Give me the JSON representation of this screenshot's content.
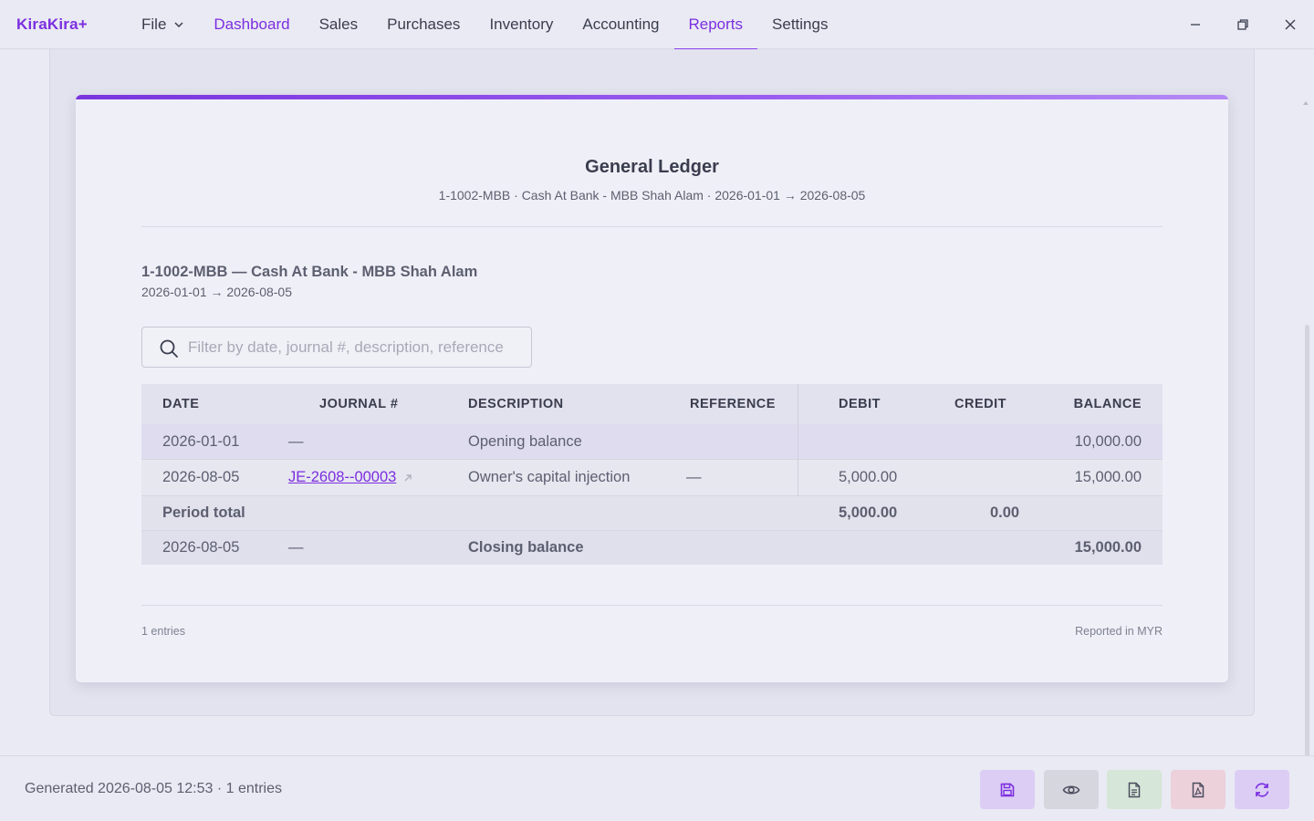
{
  "app": {
    "logo": "KiraKira+"
  },
  "menu": {
    "file": "File",
    "items": [
      "Dashboard",
      "Sales",
      "Purchases",
      "Inventory",
      "Accounting",
      "Reports",
      "Settings"
    ],
    "active": "Reports"
  },
  "report": {
    "title": "General Ledger",
    "subtitle": "1-1002-MBB · Cash At Bank - MBB Shah Alam · 2026-01-01 → 2026-08-05",
    "account_title": "1-1002-MBB — Cash At Bank - MBB Shah Alam",
    "account_range": "2026-01-01 → 2026-08-05",
    "search_placeholder": "Filter by date, journal #, description, reference",
    "columns": {
      "date": "DATE",
      "journal": "JOURNAL #",
      "description": "DESCRIPTION",
      "reference": "REFERENCE",
      "debit": "DEBIT",
      "credit": "CREDIT",
      "balance": "BALANCE"
    },
    "rows": [
      {
        "date": "2026-01-01",
        "journal": "—",
        "description": "Opening balance",
        "reference": "",
        "debit": "",
        "credit": "",
        "balance": "10,000.00"
      },
      {
        "date": "2026-08-05",
        "journal": "JE-2608--00003",
        "description": "Owner's capital injection",
        "reference": "—",
        "debit": "5,000.00",
        "credit": "",
        "balance": "15,000.00"
      }
    ],
    "period_total": {
      "label": "Period total",
      "debit": "5,000.00",
      "credit": "0.00"
    },
    "closing": {
      "date": "2026-08-05",
      "journal": "—",
      "label": "Closing balance",
      "balance": "15,000.00"
    },
    "footer_left": "1 entries",
    "footer_right": "Reported in MYR"
  },
  "status": {
    "text": "Generated 2026-08-05 12:53 · 1 entries"
  },
  "actions": [
    {
      "icon": "save-icon",
      "bg": "#dccdf5",
      "color": "#7c2ee0"
    },
    {
      "icon": "eye-icon",
      "bg": "#d6d7de",
      "color": "#4a4d5e"
    },
    {
      "icon": "document-icon",
      "bg": "#d6e6d8",
      "color": "#4a4d5e"
    },
    {
      "icon": "pdf-icon",
      "bg": "#ecd0da",
      "color": "#4a4d5e"
    },
    {
      "icon": "refresh-icon",
      "bg": "#dccdf5",
      "color": "#7c2ee0"
    }
  ],
  "colors": {
    "accent": "#7c2ee0",
    "text": "#3a3d4e",
    "muted": "#5c5f70"
  }
}
